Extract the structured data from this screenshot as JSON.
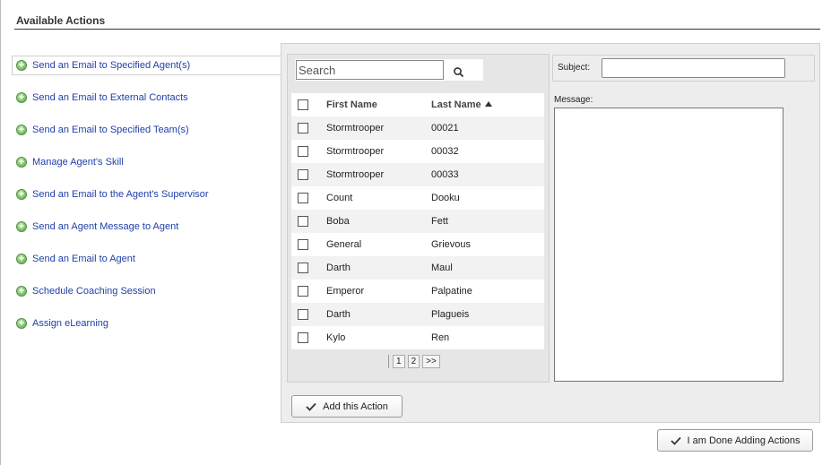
{
  "section": {
    "title": "Available Actions"
  },
  "actions": [
    {
      "label": "Send an Email to Specified Agent(s)",
      "selected": true
    },
    {
      "label": "Send an Email to External Contacts"
    },
    {
      "label": "Send an Email to Specified Team(s)"
    },
    {
      "label": "Manage Agent's Skill"
    },
    {
      "label": "Send an Email to the Agent's Supervisor"
    },
    {
      "label": "Send an Agent Message to Agent"
    },
    {
      "label": "Send an Email to Agent"
    },
    {
      "label": "Schedule Coaching Session"
    },
    {
      "label": "Assign eLearning"
    }
  ],
  "search": {
    "placeholder": "Search"
  },
  "grid": {
    "columns": {
      "first": "First Name",
      "last": "Last Name"
    },
    "sort": {
      "column": "last",
      "direction": "ascending"
    },
    "rows": [
      {
        "first": "Stormtrooper",
        "last": "00021"
      },
      {
        "first": "Stormtrooper",
        "last": "00032"
      },
      {
        "first": "Stormtrooper",
        "last": "00033"
      },
      {
        "first": "Count",
        "last": "Dooku"
      },
      {
        "first": "Boba",
        "last": "Fett"
      },
      {
        "first": "General",
        "last": "Grievous"
      },
      {
        "first": "Darth",
        "last": "Maul"
      },
      {
        "first": "Emperor",
        "last": "Palpatine"
      },
      {
        "first": "Darth",
        "last": "Plagueis"
      },
      {
        "first": "Kylo",
        "last": "Ren"
      }
    ]
  },
  "pager": {
    "pages": [
      "1",
      "2"
    ],
    "next": ">>"
  },
  "form": {
    "subject_label": "Subject:",
    "subject_value": "",
    "message_label": "Message:",
    "message_value": ""
  },
  "buttons": {
    "add_action": "Add this Action",
    "done": "I am Done Adding Actions"
  },
  "colors": {
    "link": "#1f3fa8",
    "panel": "#ededed",
    "icon_green": "#5aa84a"
  },
  "icons": {
    "action": "plus-circle-icon",
    "search": "magnifier-icon",
    "button": "checkmark-icon"
  }
}
